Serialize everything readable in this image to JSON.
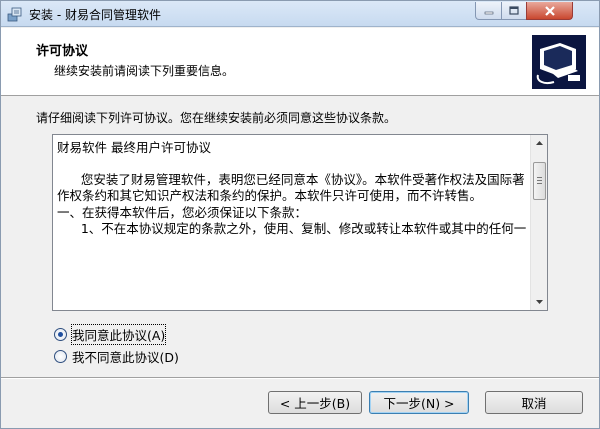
{
  "window": {
    "title": "安装 - 财易合同管理软件"
  },
  "header": {
    "title": "许可协议",
    "subtitle": "继续安装前请阅读下列重要信息。"
  },
  "instruction": "请仔细阅读下列许可协议。您在继续安装前必须同意这些协议条款。",
  "license": {
    "lines": [
      "财易软件 最终用户许可协议",
      "",
      "      您安装了财易管理软件，表明您已经同意本《协议》。本软件受著作权法及国际著",
      "作权条约和其它知识产权法和条约的保护。本软件只许可使用，而不许转售。",
      "一、在获得本软件后，您必须保证以下条款：",
      "      1、不在本协议规定的条款之外，使用、复制、修改或转让本软件或其中的任何一"
    ]
  },
  "radios": {
    "accept_label": "我同意此协议(A)",
    "reject_label": "我不同意此协议(D)",
    "selected": "accept"
  },
  "buttons": {
    "back": "< 上一步(B)",
    "next": "下一步(N) >",
    "cancel": "取消"
  },
  "icons": {
    "app": "installer-app-icon",
    "logo": "computer-install-logo",
    "minimize": "minimize-icon",
    "maximize": "maximize-icon",
    "close": "close-icon",
    "scroll_up": "scroll-up-arrow-icon",
    "scroll_down": "scroll-down-arrow-icon"
  },
  "colors": {
    "header_bg": "#ffffff",
    "dialog_bg": "#f0f0f0",
    "close_button": "#c9472f",
    "default_button_border": "#3c7fb1"
  }
}
